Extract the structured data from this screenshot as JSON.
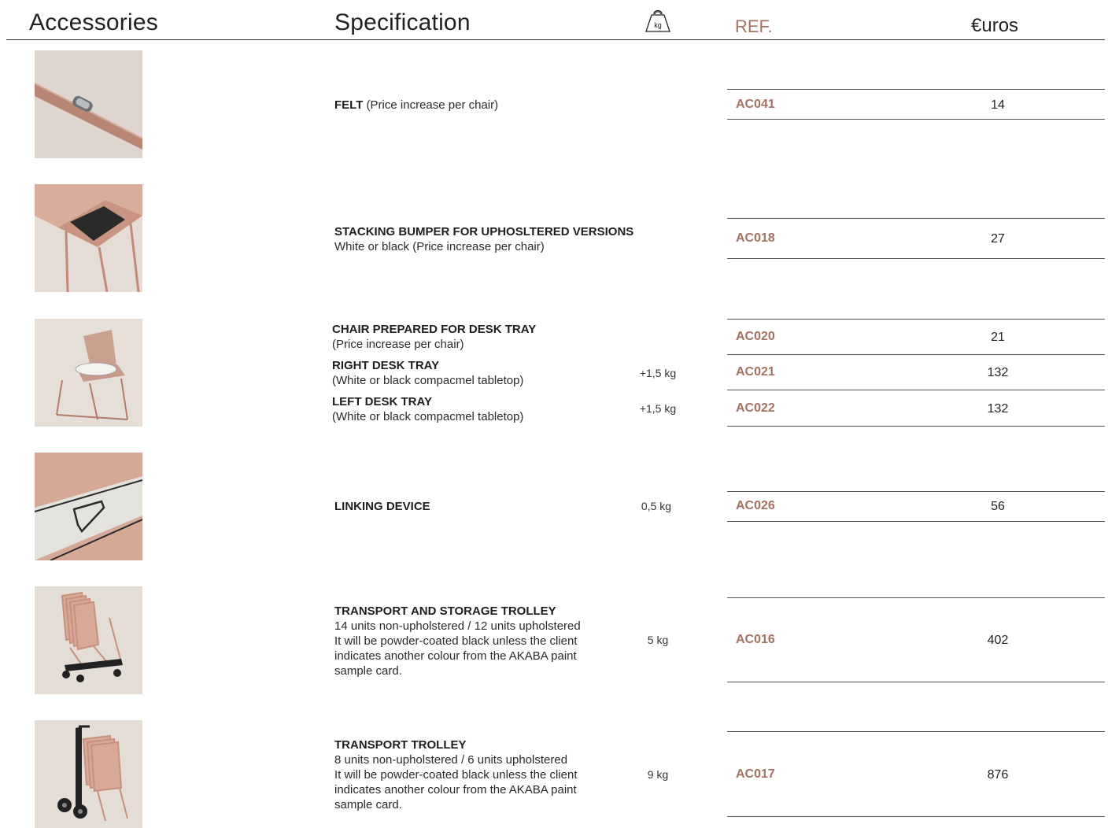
{
  "header": {
    "accessories": "Accessories",
    "specification": "Specification",
    "weight_icon_text": "kg",
    "weight_icon": "weight-bag-icon",
    "ref": "REF.",
    "euros": "€uros"
  },
  "colors": {
    "accent": "#a27262",
    "text": "#1f1f1f",
    "photo_bg": "#ddd6cf",
    "chair": "#c9998a"
  },
  "rows": [
    {
      "image": "felt-glide-photo",
      "title": "FELT",
      "title_suffix": " (Price increase per chair)",
      "ref": "AC041",
      "price": "14"
    },
    {
      "image": "stacking-bumper-photo",
      "title": "STACKING BUMPER FOR UPHOSLTERED VERSIONS",
      "desc": "White or black (Price increase per chair)",
      "ref": "AC018",
      "price": "27"
    },
    {
      "image": "desk-tray-chair-photo",
      "items": [
        {
          "title": "CHAIR PREPARED FOR DESK TRAY",
          "desc": "(Price increase per chair)",
          "weight": "",
          "ref": "AC020",
          "price": "21"
        },
        {
          "title": "RIGHT DESK TRAY",
          "desc": "(White or black compacmel tabletop)",
          "weight": "+1,5 kg",
          "ref": "AC021",
          "price": "132"
        },
        {
          "title": "LEFT DESK TRAY",
          "desc": "(White or black compacmel tabletop)",
          "weight": "+1,5 kg",
          "ref": "AC022",
          "price": "132"
        }
      ]
    },
    {
      "image": "linking-device-photo",
      "title": "LINKING DEVICE",
      "weight": "0,5 kg",
      "ref": "AC026",
      "price": "56"
    },
    {
      "image": "storage-trolley-photo",
      "title": "TRANSPORT AND STORAGE TROLLEY",
      "desc_lines": [
        "14 units non-upholstered / 12 units upholstered",
        "It will be powder-coated black unless the client",
        "indicates another colour from the AKABA paint",
        "sample card."
      ],
      "weight": "5 kg",
      "ref": "AC016",
      "price": "402"
    },
    {
      "image": "transport-trolley-photo",
      "title": "TRANSPORT TROLLEY",
      "desc_lines": [
        "8 units non-upholstered / 6 units upholstered",
        "It will be powder-coated black unless the client",
        "indicates another colour from the AKABA paint",
        "sample card."
      ],
      "weight": "9 kg",
      "ref": "AC017",
      "price": "876"
    }
  ]
}
